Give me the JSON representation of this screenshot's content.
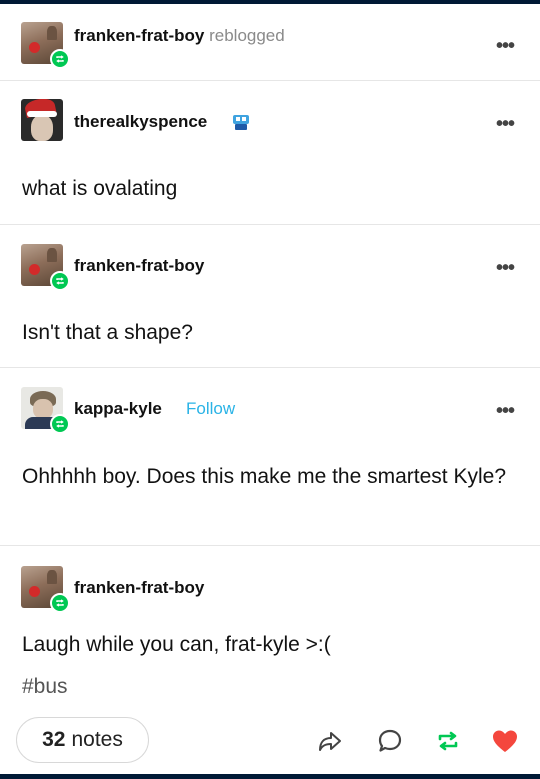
{
  "header": {
    "username": "franken-frat-boy",
    "action": "reblogged"
  },
  "posts": [
    {
      "username": "therealkyspence",
      "text": "what is ovalating",
      "follow": ""
    },
    {
      "username": "franken-frat-boy",
      "text": "Isn't that a shape?",
      "follow": ""
    },
    {
      "username": "kappa-kyle",
      "text": "Ohhhhh boy. Does this make me the smartest Kyle?",
      "follow": "Follow"
    },
    {
      "username": "franken-frat-boy",
      "text": "Laugh while you can, frat-kyle >:(",
      "follow": ""
    }
  ],
  "tags": [
    "#bus"
  ],
  "footer": {
    "notes_count": "32",
    "notes_label": "notes"
  },
  "more_glyph": "•••",
  "colors": {
    "reblog_green": "#00c853",
    "follow_blue": "#2ab3e6",
    "like_red": "#f4473d",
    "dashboard_navy": "#001935"
  },
  "icons": [
    "reblog-badge-icon",
    "share-icon",
    "reply-icon",
    "reblog-icon",
    "like-heart-icon",
    "more-options-icon",
    "verified-mascot-icon"
  ]
}
